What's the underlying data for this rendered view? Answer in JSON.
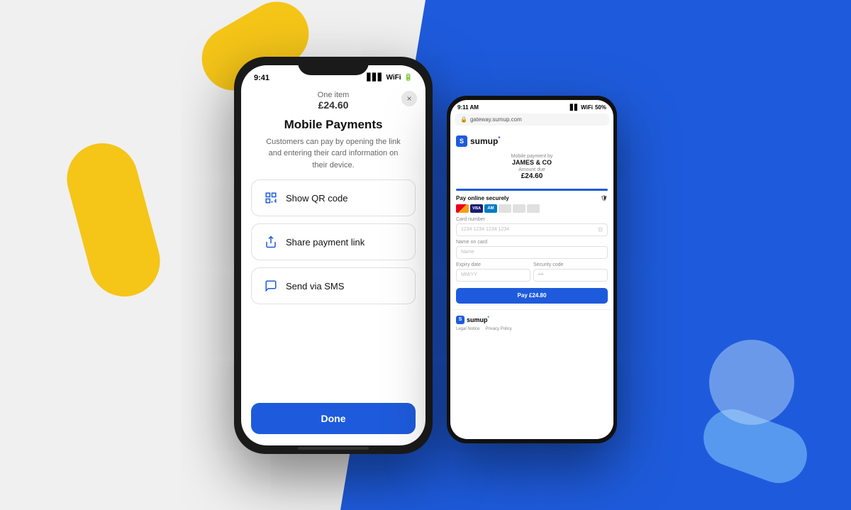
{
  "background": {
    "left_color": "#f0f0f0",
    "right_color": "#1e5bdc"
  },
  "blobs": {
    "yellow_top": "#f5c518",
    "yellow_left": "#f5c518",
    "blue_light": "#6eb3f7"
  },
  "iphone": {
    "status_time": "9:41",
    "modal": {
      "item_count": "One item",
      "item_price": "£24.60",
      "close_label": "×",
      "title": "Mobile Payments",
      "subtitle": "Customers can pay by opening the link and entering their card information on their device.",
      "options": [
        {
          "icon": "qr-icon",
          "label": "Show QR code"
        },
        {
          "icon": "share-icon",
          "label": "Share payment link"
        },
        {
          "icon": "sms-icon",
          "label": "Send via SMS"
        }
      ],
      "done_button": "Done"
    }
  },
  "android": {
    "status_time": "9:11 AM",
    "status_battery": "50%",
    "browser_url": "gateway.sumup.com",
    "sumup_logo": "sumup*",
    "payment": {
      "by_label": "Mobile payment by",
      "merchant": "JAMES & CO",
      "amount_label": "Amount due",
      "amount": "£24.60"
    },
    "form": {
      "pay_online_label": "Pay online securely",
      "card_number_label": "Card number",
      "card_number_placeholder": "1234 1234 1234 1234",
      "name_label": "Name on card",
      "name_placeholder": "Name",
      "expiry_label": "Expiry date",
      "expiry_placeholder": "MM/YY",
      "security_label": "Security code",
      "security_placeholder": "•••",
      "pay_button": "Pay £24.80"
    },
    "footer": {
      "logo": "sumup*",
      "legal_label": "Legal Notice",
      "privacy_label": "Privacy Policy"
    }
  }
}
